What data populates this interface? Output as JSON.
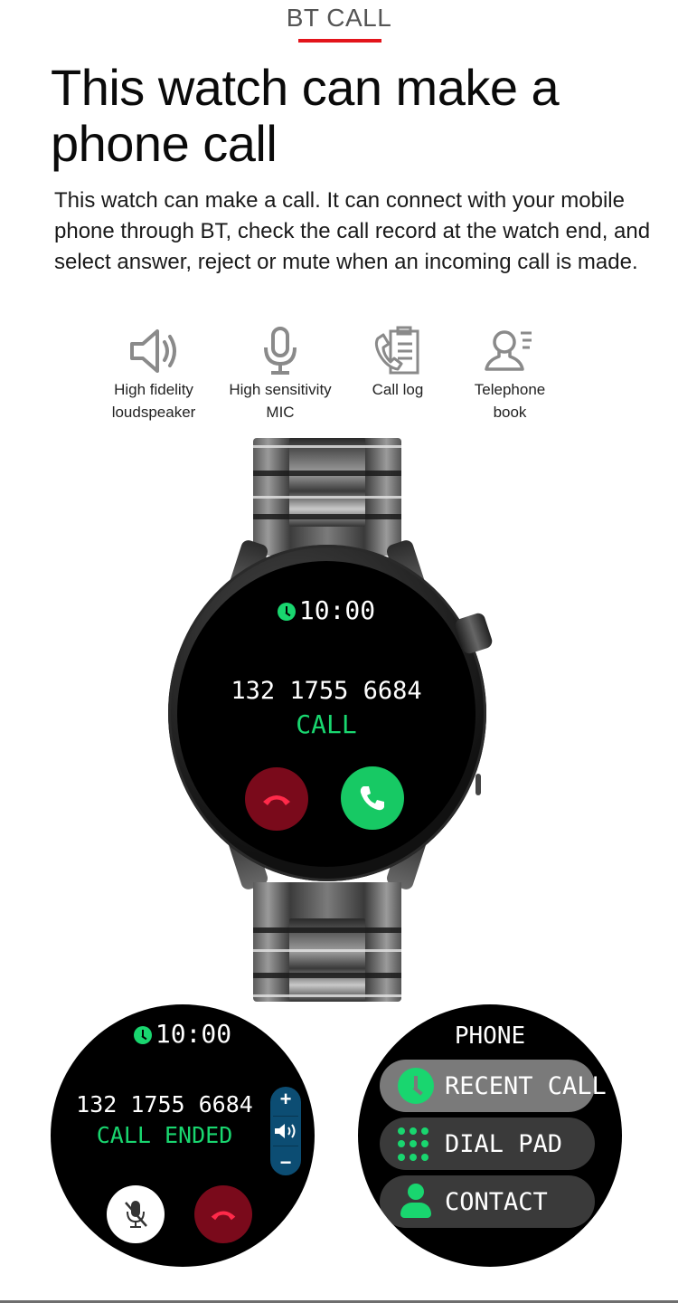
{
  "section": {
    "label": "BT  CALL",
    "underline_color": "#e3141b"
  },
  "headline": "This watch can make a phone call",
  "description": "This watch can make a call. It can connect with your mobile phone through BT, check the call record at the watch end, and select answer, reject or mute when an incoming call is made.",
  "features": [
    {
      "icon": "speaker-icon",
      "label_line1": "High fidelity",
      "label_line2": "loudspeaker"
    },
    {
      "icon": "microphone-icon",
      "label_line1": "High sensitivity",
      "label_line2": "MIC"
    },
    {
      "icon": "call-log-icon",
      "label_line1": "Call log",
      "label_line2": ""
    },
    {
      "icon": "telephone-book-icon",
      "label_line1": "Telephone",
      "label_line2": "book"
    }
  ],
  "main_watch": {
    "time": "10:00",
    "number": "132 1755 6684",
    "status": "CALL",
    "buttons": {
      "decline": "decline-call",
      "accept": "accept-call"
    }
  },
  "call_ended_watch": {
    "time": "10:00",
    "number": "132 1755 6684",
    "status": "CALL ENDED",
    "volume": {
      "plus": "+",
      "minus": "−"
    }
  },
  "phone_menu_watch": {
    "title": "PHONE",
    "items": [
      {
        "label": "RECENT CALL",
        "icon": "recent-call-icon",
        "active": true
      },
      {
        "label": "DIAL PAD",
        "icon": "dial-pad-icon",
        "active": false
      },
      {
        "label": "CONTACT",
        "icon": "contact-icon",
        "active": false
      }
    ]
  },
  "colors": {
    "accent_green": "#19d66f",
    "decline_red": "#7a0a1b",
    "volume_blue": "#0c4d73"
  }
}
